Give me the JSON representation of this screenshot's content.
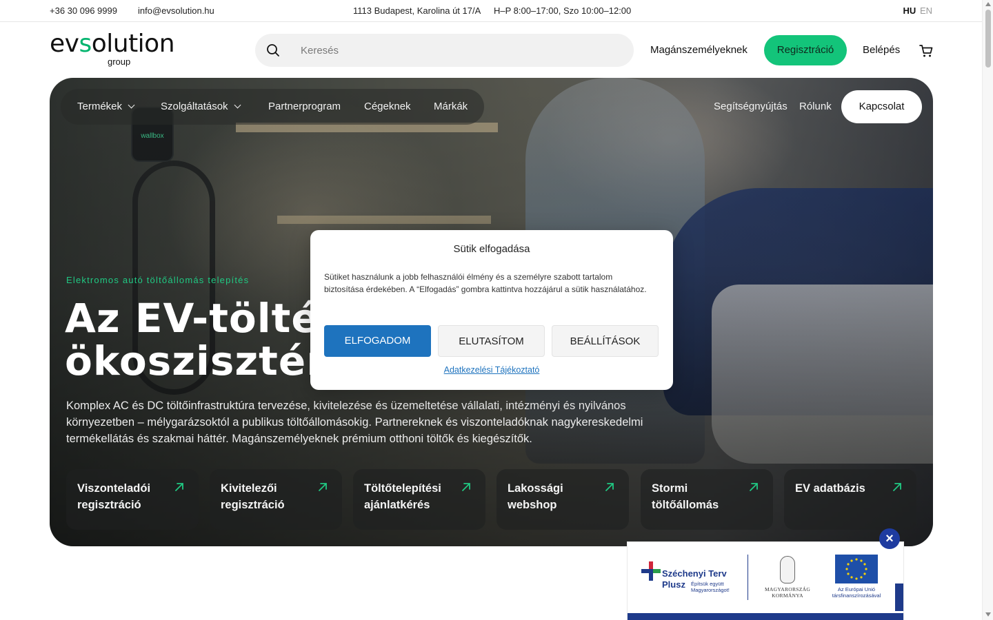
{
  "topbar": {
    "phone": "+36 30 096 9999",
    "email": "info@evsolution.hu",
    "address": "1113 Budapest, Karolina út 17/A",
    "hours": "H–P 8:00–17:00, Szo 10:00–12:00",
    "lang_active": "HU",
    "lang_other": "EN"
  },
  "header": {
    "logo_text_1": "ev",
    "logo_text_s": "s",
    "logo_text_2": "olution",
    "logo_sub": "group",
    "search_placeholder": "Keresés",
    "link_private": "Magánszemélyeknek",
    "register_label": "Regisztráció",
    "login_label": "Belépés",
    "cart_icon": "cart-icon"
  },
  "nav": {
    "items": [
      {
        "label": "Termékek",
        "has_dropdown": true
      },
      {
        "label": "Szolgáltatások",
        "has_dropdown": true
      },
      {
        "label": "Partnerprogram",
        "has_dropdown": false
      },
      {
        "label": "Cégeknek",
        "has_dropdown": false
      },
      {
        "label": "Márkák",
        "has_dropdown": false
      }
    ],
    "right_items": [
      "Segítségnyújtás",
      "Rólunk"
    ],
    "contact_label": "Kapcsolat"
  },
  "hero": {
    "kicker": "Elektromos autó töltőállomás telepítés",
    "headline": "Az EV-töltés\nökoszisztéma",
    "description": "Komplex AC és DC töltőinfrastruktúra tervezése, kivitelezése és üzemeltetése vállalati, intézményi és nyilvános környezetben – mélygarázsoktól a publikus töltőállomásokig. Partnereknek és viszonteladóknak nagykereskedelmi termékellátás és szakmai háttér. Magánszemélyeknek prémium otthoni töltők és kiegészítők.",
    "charger_brand": "wallbox",
    "tiles": [
      {
        "label": "Viszonteladói regisztráció"
      },
      {
        "label": "Kivitelezői regisztráció"
      },
      {
        "label": "Töltőtelepítési ajánlatkérés"
      },
      {
        "label": "Lakossági webshop"
      },
      {
        "label": "Stormi töltőállomás"
      },
      {
        "label": "EV adatbázis"
      }
    ]
  },
  "cookie": {
    "title": "Sütik elfogadása",
    "body": "Sütiket használunk a jobb felhasználói élmény és a személyre szabott tartalom biztosítása érdekében. A “Elfogadás” gombra kattintva hozzájárul a sütik használatához.",
    "accept": "ELFOGADOM",
    "deny": "ELUTASÍTOM",
    "settings": "BEÁLLÍTÁSOK",
    "policy": "Adatkezelési Tájékoztató"
  },
  "banner": {
    "close": "×",
    "szt_line1": "Széchenyi Terv",
    "szt_line2": "Plusz",
    "szt_tagline": "Építsük együtt Magyarországot!",
    "gov_text": "MAGYARORSZÁG KORMÁNYA",
    "eu_text": "Az Európai Unió társfinanszírozásával"
  },
  "colors": {
    "brand_green": "#13c47a",
    "accept_blue": "#1e73be",
    "banner_blue": "#1e3a8a"
  }
}
